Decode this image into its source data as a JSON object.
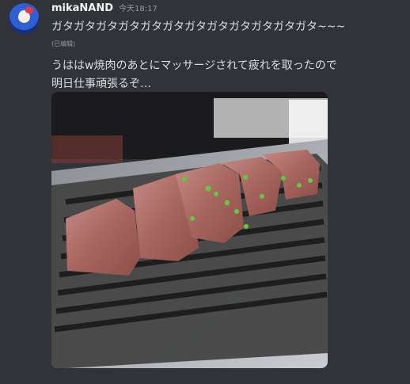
{
  "message": {
    "author": "mikaNAND",
    "timestamp": "今天18:17",
    "first_line": "ガタガタガタガタガタガタガタガタガタガタガタガタ~~~",
    "edited_label": "(已编辑)",
    "second_message_line1": "うははw焼肉のあとにマッサージされて疲れを取ったので",
    "second_message_line2": "明日仕事頑張るぞ…"
  },
  "colors": {
    "background": "#313338",
    "username": "#f2f3f5",
    "text": "#dbdee1",
    "muted": "#949ba4"
  },
  "attachment": {
    "type": "photo",
    "subject": "grilled meat on tabletop grill"
  }
}
